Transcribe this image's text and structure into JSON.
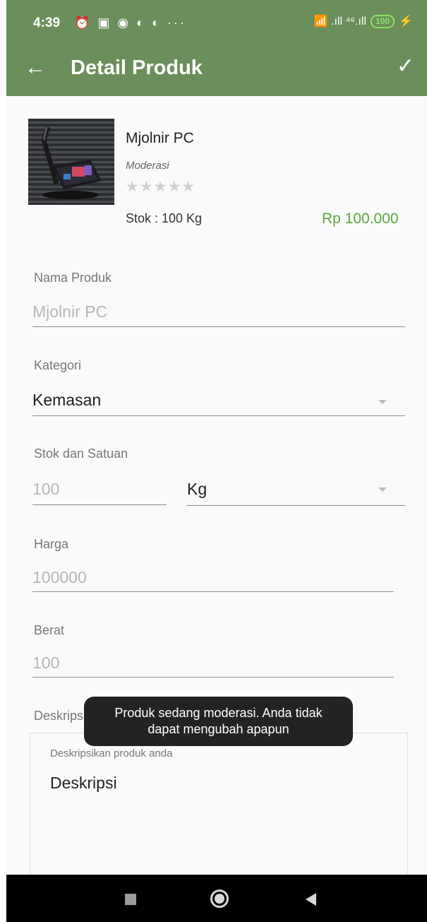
{
  "status_bar": {
    "time": "4:39",
    "notif_icons": "⏰ ▣ ◉ ◐ ◐ ···",
    "signal_text": "📶 .ıll ⁴⁶.ıll",
    "battery": "100"
  },
  "app_bar": {
    "back_icon": "←",
    "title": "Detail Produk",
    "confirm_icon": "✓"
  },
  "product": {
    "name": "Mjolnir PC",
    "status": "Moderasi",
    "stars": "★★★★★",
    "rating": 0,
    "stock": "Stok : 100 Kg",
    "price": "Rp 100.000"
  },
  "form": {
    "nama_produk": {
      "label": "Nama Produk",
      "value": "Mjolnir PC"
    },
    "kategori": {
      "label": "Kategori",
      "value": "Kemasan"
    },
    "stok_satuan": {
      "label": "Stok dan Satuan",
      "stock_value": "100",
      "unit_value": "Kg"
    },
    "harga": {
      "label": "Harga",
      "value": "100000"
    },
    "berat": {
      "label": "Berat",
      "value": "100"
    },
    "deskripsi": {
      "label": "Deskripsi",
      "hint": "Deskripsikan produk anda",
      "value": "Deskripsi"
    }
  },
  "toast": {
    "message": "Produk sedang moderasi. Anda tidak dapat mengubah apapun"
  },
  "colors": {
    "primary": "#6b8f5a",
    "price": "#5aa83f",
    "battery": "#8ce06a"
  }
}
